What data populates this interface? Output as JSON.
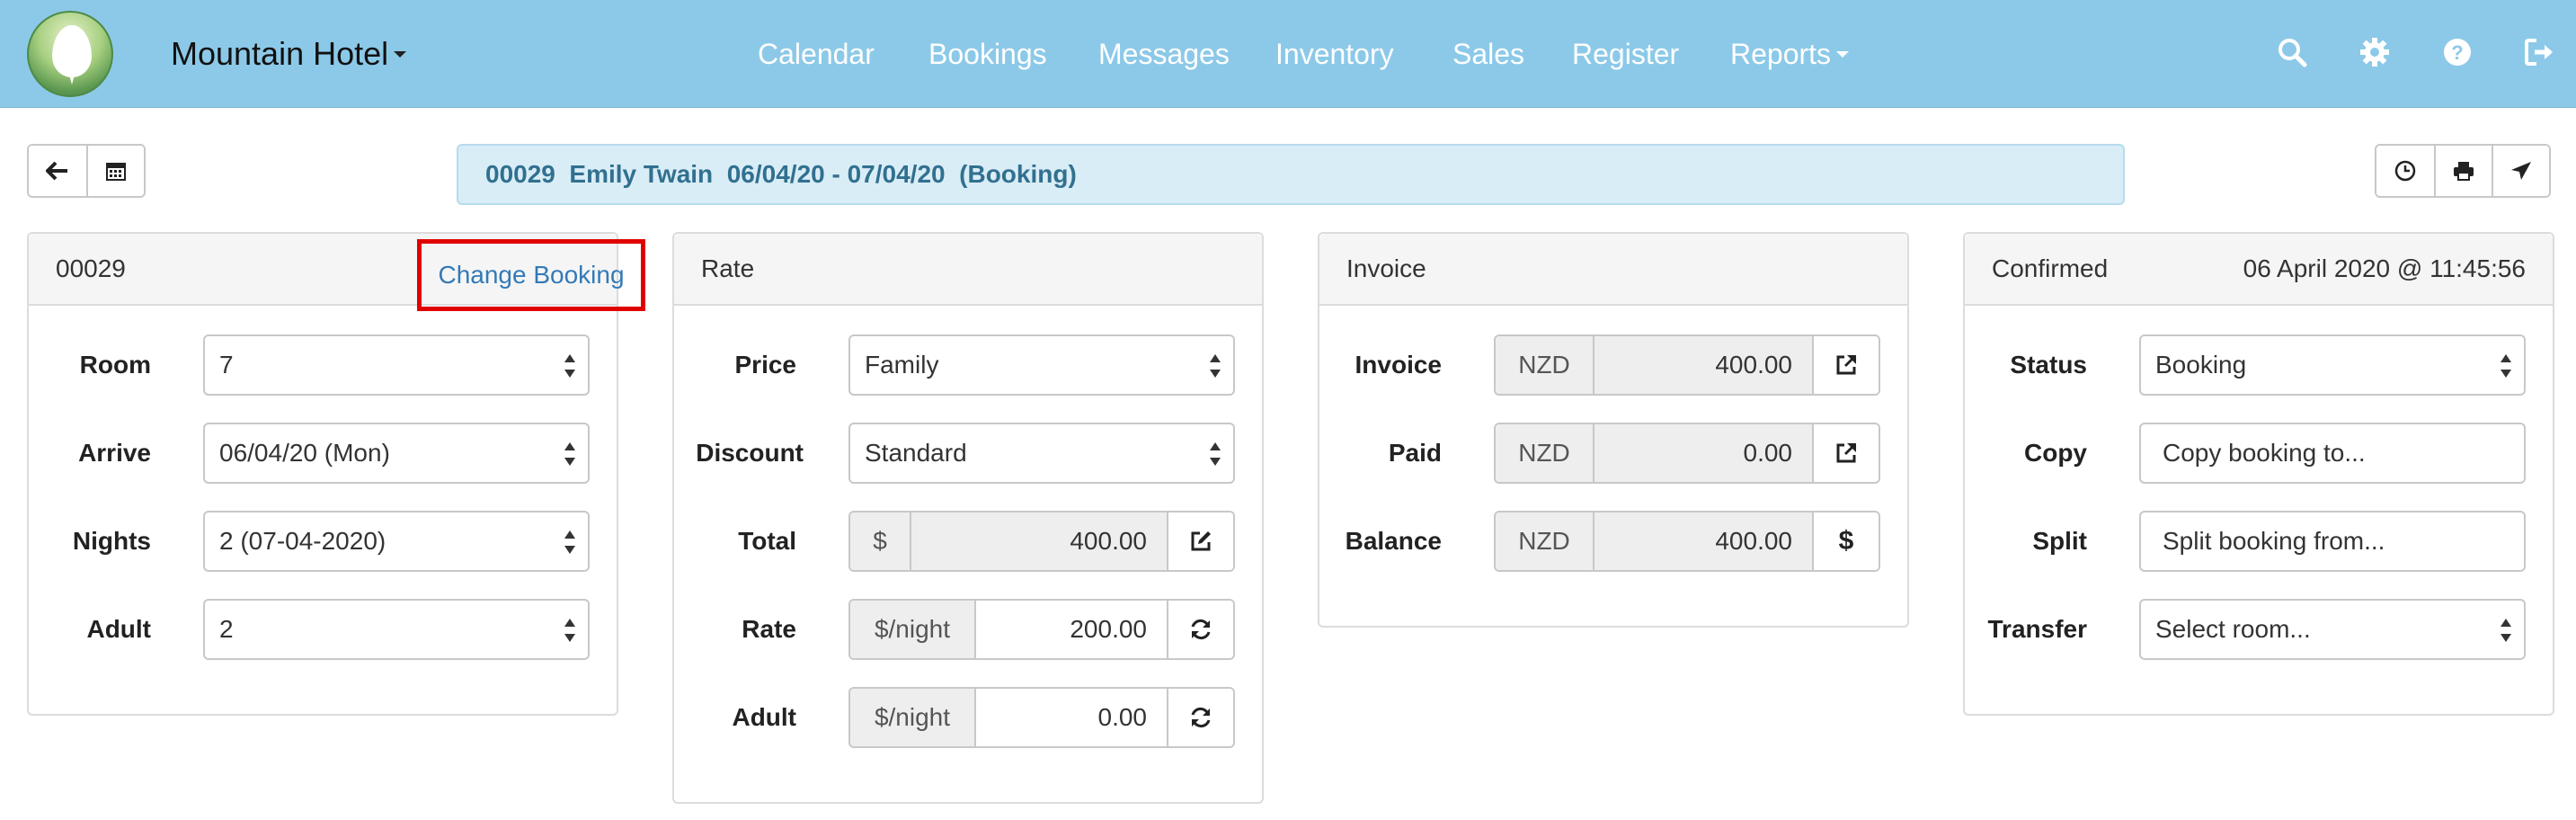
{
  "app": {
    "name": "Mountain Hotel"
  },
  "nav": {
    "items": [
      "Calendar",
      "Bookings",
      "Messages",
      "Inventory",
      "Sales",
      "Register",
      "Reports"
    ],
    "icons": [
      "search-icon",
      "gear-icon",
      "help-icon",
      "logout-icon"
    ]
  },
  "toolbar": {
    "left_icons": [
      "arrow-left-icon",
      "calendar-icon"
    ],
    "right_icons": [
      "clock-icon",
      "print-icon",
      "send-icon"
    ],
    "booking_summary": "00029  Emily Twain  06/04/20 - 07/04/20  (Booking)"
  },
  "booking_panel": {
    "id": "00029",
    "change_label": "Change Booking",
    "rows": [
      {
        "label": "Room",
        "value": "7"
      },
      {
        "label": "Arrive",
        "value": "06/04/20  (Mon)"
      },
      {
        "label": "Nights",
        "value": "2  (07-04-2020)"
      },
      {
        "label": "Adult",
        "value": "2"
      }
    ]
  },
  "rate_panel": {
    "title": "Rate",
    "price_label": "Price",
    "price_value": "Family",
    "discount_label": "Discount",
    "discount_value": "Standard",
    "total_label": "Total",
    "total_unit": "$",
    "total_value": "400.00",
    "rate_label": "Rate",
    "rate_unit": "$/night",
    "rate_value": "200.00",
    "adult_label": "Adult",
    "adult_unit": "$/night",
    "adult_value": "0.00"
  },
  "invoice_panel": {
    "title": "Invoice",
    "rows": [
      {
        "label": "Invoice",
        "currency": "NZD",
        "value": "400.00",
        "action_icon": "external-link-icon"
      },
      {
        "label": "Paid",
        "currency": "NZD",
        "value": "0.00",
        "action_icon": "external-link-icon"
      },
      {
        "label": "Balance",
        "currency": "NZD",
        "value": "400.00",
        "action_symbol": "$"
      }
    ]
  },
  "status_panel": {
    "title": "Confirmed",
    "timestamp": "06 April 2020 @ 11:45:56",
    "status_label": "Status",
    "status_value": "Booking",
    "copy_label": "Copy",
    "copy_value": "Copy booking to...",
    "split_label": "Split",
    "split_value": "Split booking from...",
    "transfer_label": "Transfer",
    "transfer_placeholder": "Select room..."
  },
  "colors": {
    "navbar": "#8cc9e8",
    "info_bar": "#d9edf7",
    "info_text": "#31708f",
    "link": "#337ab7",
    "highlight": "#e00000"
  }
}
